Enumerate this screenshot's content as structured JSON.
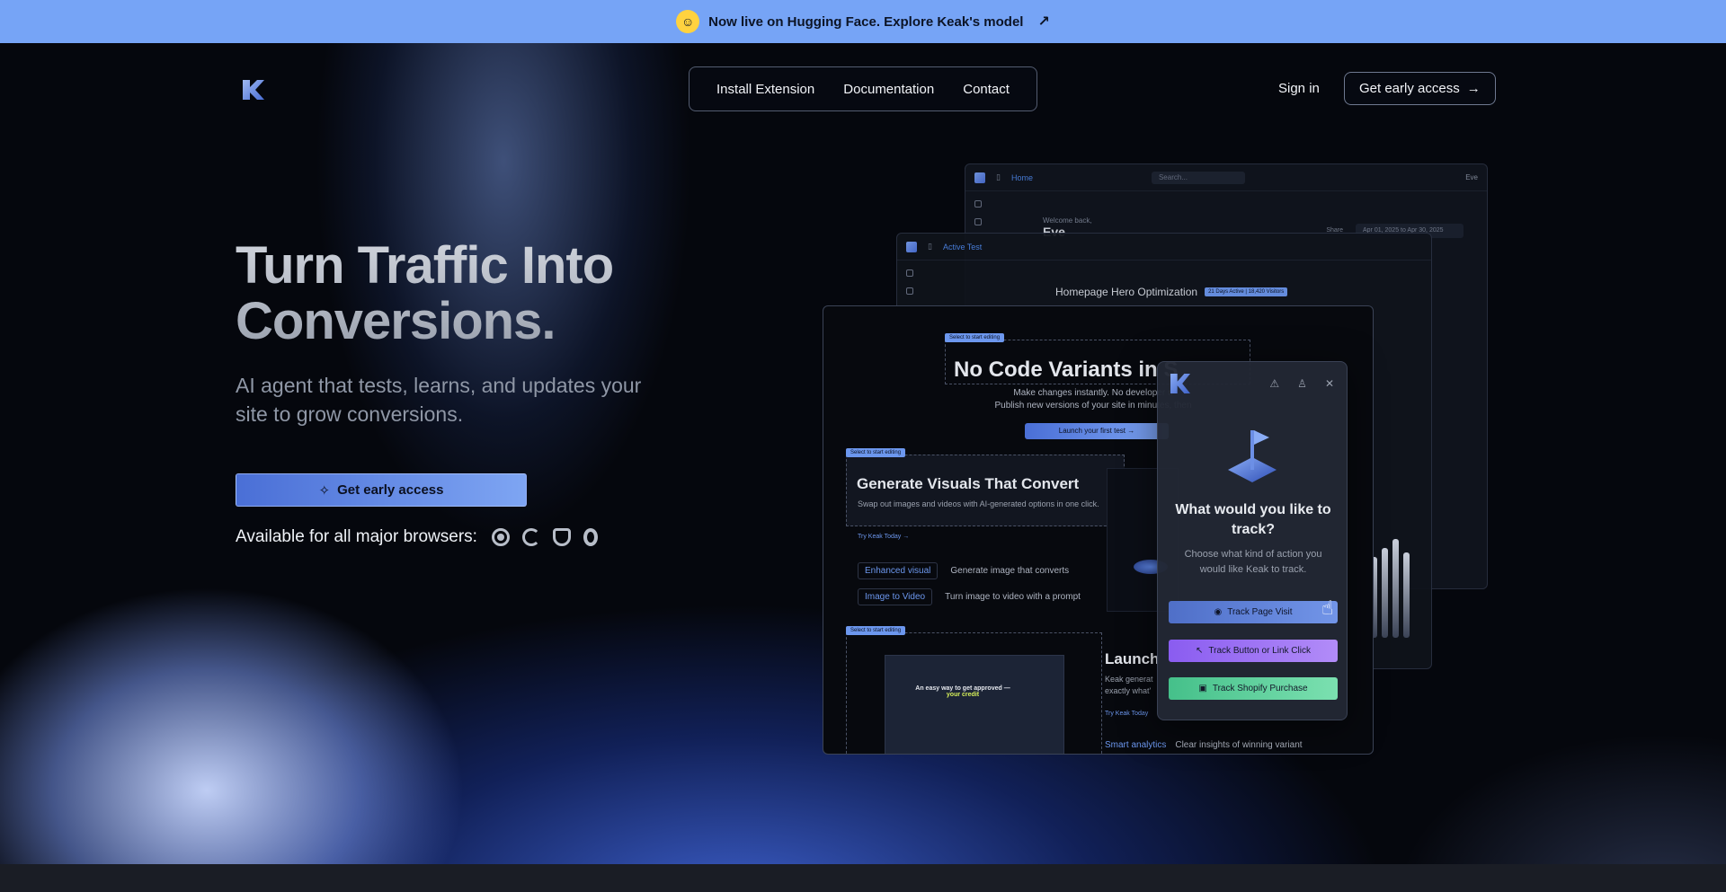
{
  "announcement": {
    "text": "Now live on Hugging Face. Explore Keak's model",
    "icon": "hugging-face-icon",
    "arrow": "↗"
  },
  "nav": {
    "items": [
      "Install Extension",
      "Documentation",
      "Contact"
    ],
    "sign_in": "Sign in",
    "cta": "Get early access",
    "cta_arrow": "→"
  },
  "hero": {
    "title_line1": "Turn Traffic Into",
    "title_line2": "Conversions.",
    "subtitle": "AI agent that tests, learns, and updates your site to grow conversions.",
    "cta": "Get early access",
    "browsers_label": "Available for all major browsers:",
    "browsers": [
      "chrome-icon",
      "edge-icon",
      "brave-icon",
      "opera-icon"
    ]
  },
  "mockup": {
    "dashboard": {
      "tab": "Home",
      "search_placeholder": "Search...",
      "user": "Eve",
      "welcome": "Welcome back,",
      "name": "Eve",
      "share": "Share",
      "date_range": "Apr 01, 2025 to Apr 30, 2025"
    },
    "active_test": {
      "tab": "Active Test",
      "title": "Homepage Hero Optimization",
      "badge": "21 Days Active | 18,420 Visitors"
    },
    "editor": {
      "tag": "Select to start editing",
      "headline": "No Code Variants in S",
      "sub_line1": "Make changes instantly. No developer n",
      "sub_line2": "Publish new versions of your site in minutes, then",
      "launch_btn": "Launch your first test →",
      "visuals_title": "Generate Visuals That Convert",
      "visuals_sub": "Swap out images and videos with AI-generated options in one click.",
      "try_link": "Try Keak Today →",
      "feature1_chip": "Enhanced visual",
      "feature1_text": "Generate image that converts",
      "feature2_chip": "Image to Video",
      "feature2_text": "Turn image to video with a prompt",
      "shot_text_a": "An easy way to get approved —",
      "shot_text_b": "your credit",
      "launch_side": "Launch",
      "launch_side_sub": "Keak generat exactly what'",
      "try_link2": "Try Keak Today",
      "smart_chip": "Smart analytics",
      "smart_text": "Clear insights of winning variant"
    },
    "popover": {
      "title": "What would you like to track?",
      "subtitle": "Choose what kind of action you would like Keak to track.",
      "btn1": "Track Page Visit",
      "btn2": "Track Button or Link Click",
      "btn3": "Track Shopify Purchase"
    }
  },
  "colors": {
    "announcement_bg": "#76a4f6",
    "background": "#05070d",
    "accent": "#6c97ee"
  }
}
